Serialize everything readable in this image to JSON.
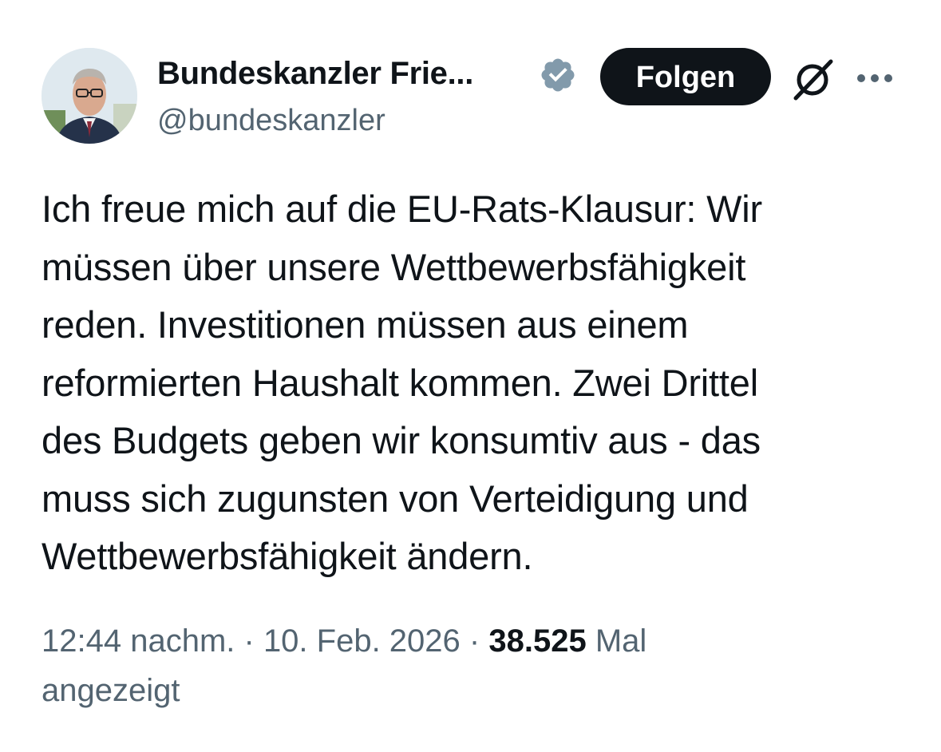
{
  "author": {
    "display_name": "Bundeskanzler Frie...",
    "handle": "@bundeskanzler",
    "verified": true,
    "verified_badge_color": "#829aab",
    "avatar_icon": "profile-photo-man-with-glasses"
  },
  "actions": {
    "follow_label": "Folgen",
    "grok_icon": "slash-circle-icon",
    "more_icon": "more-dots-icon"
  },
  "tweet": {
    "lines": [
      "Ich freue mich auf die EU-Rats-Klausur: Wir",
      "müssen über unsere Wettbewerbsfähigkeit",
      "reden. Investitionen müssen aus einem",
      "reformierten Haushalt kommen. Zwei Drittel",
      "des Budgets geben wir konsumtiv aus - das",
      "muss sich zugunsten von Verteidigung und",
      "Wettbewerbsfähigkeit ändern."
    ]
  },
  "meta": {
    "time": "12:44 nachm.",
    "separator": " · ",
    "date": "10. Feb. 2026",
    "views_count": "38.525",
    "views_suffix_1": "Mal",
    "views_suffix_2": "angezeigt"
  },
  "colors": {
    "text": "#0f1419",
    "secondary": "#536471",
    "button_bg": "#0f1419",
    "button_text": "#ffffff"
  }
}
